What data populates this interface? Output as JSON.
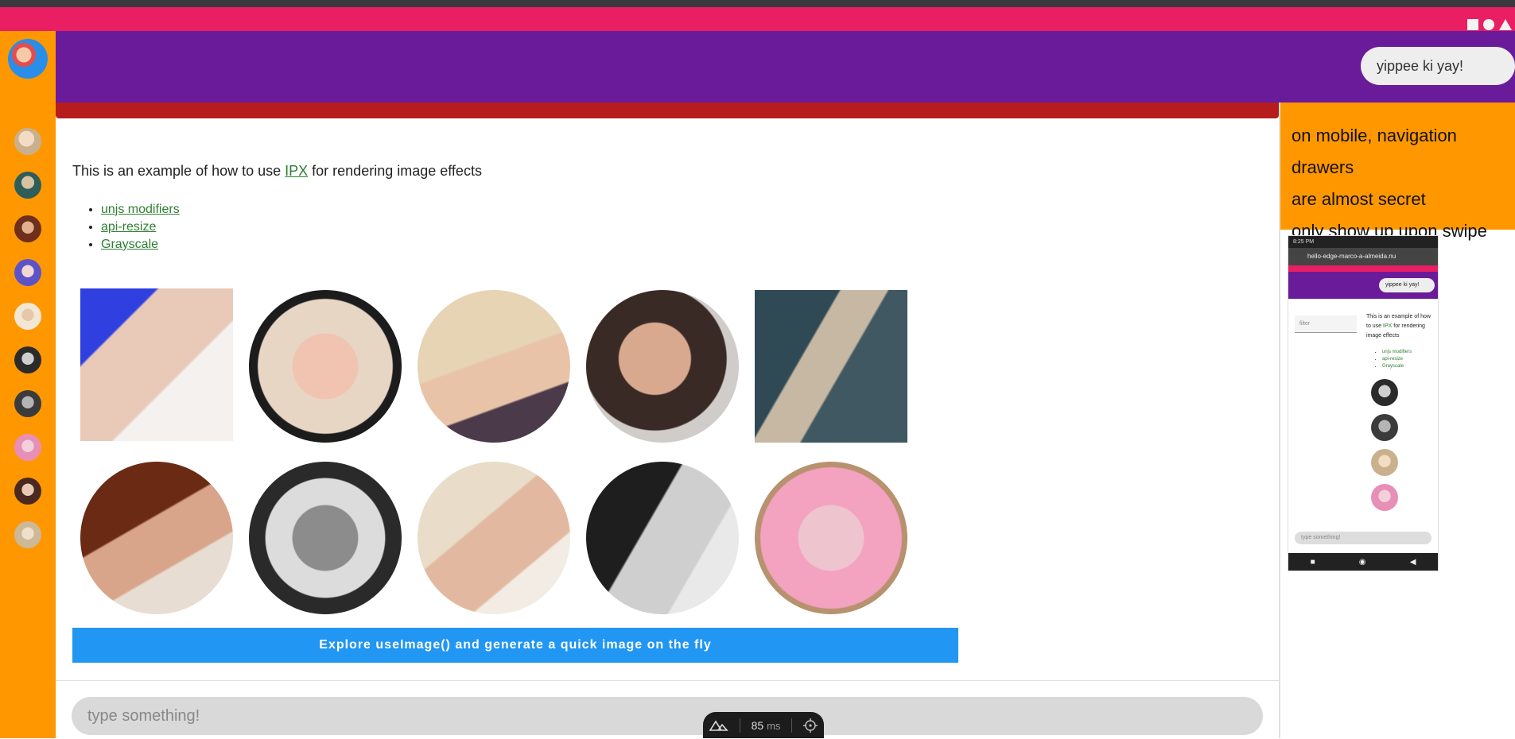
{
  "header": {
    "search_value": "yippee ki yay!"
  },
  "intro": {
    "prefix": "This is an example of how to use ",
    "link": "IPX",
    "suffix": " for rendering image effects"
  },
  "links": [
    "unjs modifiers",
    "api-resize",
    "Grayscale"
  ],
  "explore_button": "Explore useImage() and generate a quick image on the fly",
  "message_input": {
    "placeholder": "type something!"
  },
  "perf": {
    "value": "85",
    "unit": "ms"
  },
  "note": {
    "lines": [
      "on mobile, navigation drawers",
      "are almost secret",
      "only show up upon swipe"
    ]
  },
  "phone": {
    "status": "8:25 PM",
    "url": "hello-edge-marco-a-almeida.nu",
    "search": "yippee ki yay!",
    "filter": "filter",
    "text_prefix": "This is an example of how to use ",
    "text_link": "IPX",
    "text_suffix": " for rendering image effects",
    "links": [
      "unjs modifiers",
      "api-resize",
      "Grayscale"
    ],
    "input": "type something!"
  },
  "colors": {
    "pink": "#e91e63",
    "purple": "#6a1b9a",
    "orange": "#ff9800",
    "red": "#b71c1c",
    "blue": "#2196f3",
    "link": "#2e7d32"
  },
  "icons": [
    "nuxt-logo-icon",
    "crosshair-icon",
    "square-icon",
    "circle-icon",
    "triangle-icon"
  ]
}
